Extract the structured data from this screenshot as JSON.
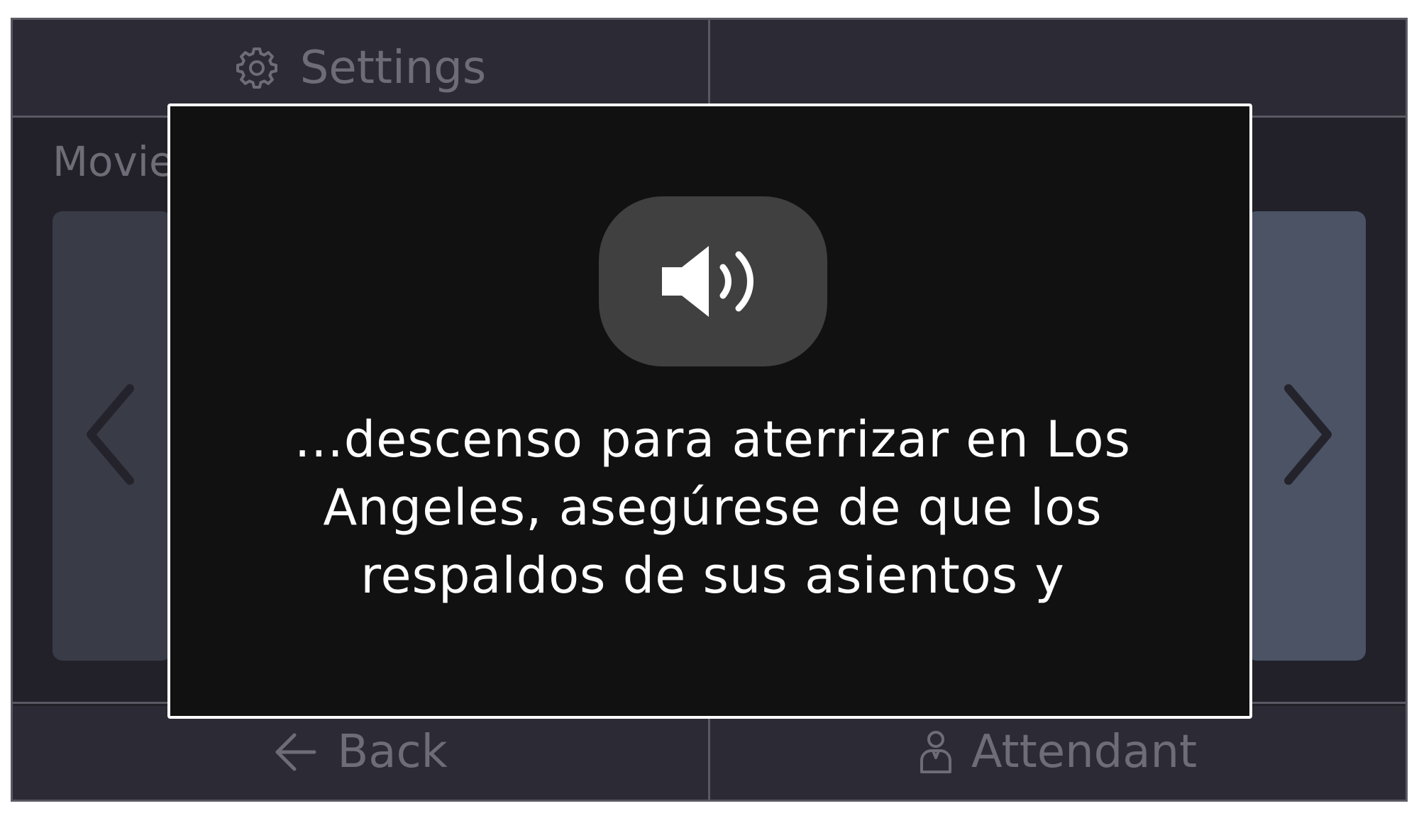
{
  "header": {
    "settings_label": "Settings",
    "right_label": ""
  },
  "content": {
    "section_title": "Movies"
  },
  "footer": {
    "back_label": "Back",
    "attendant_label": "Attendant"
  },
  "announcement": {
    "icon": "speaker-volume-icon",
    "text": "...descenso para aterrizar en Los Angeles, asegúrese de que los respaldos de sus asientos y"
  },
  "colors": {
    "frame_bg": "#2c2a35",
    "content_bg": "#22212a",
    "overlay_bg": "#111111",
    "overlay_border": "#ffffff",
    "muted_text": "#6e6c76",
    "badge_bg": "#404040",
    "nav_left_bg": "#393b47",
    "nav_right_bg": "#4b5365"
  }
}
